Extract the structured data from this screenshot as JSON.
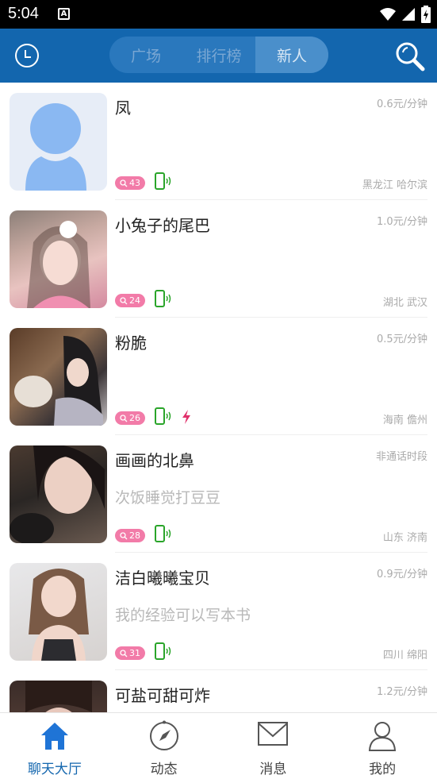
{
  "status_bar": {
    "time": "5:04",
    "notif_letter": "A"
  },
  "header": {
    "tabs": [
      {
        "label": "广场"
      },
      {
        "label": "排行榜"
      },
      {
        "label": "新人",
        "active": true
      }
    ],
    "icons": {
      "left": "clock-icon",
      "right": "search-icon"
    }
  },
  "users": [
    {
      "name": "凤",
      "price": "0.6元/分钟",
      "signature": "",
      "location": "黑龙江 哈尔滨",
      "count": "43",
      "hot": false,
      "avatar": "default"
    },
    {
      "name": "小兔子的尾巴",
      "price": "1.0元/分钟",
      "signature": "",
      "location": "湖北 武汉",
      "count": "24",
      "hot": false,
      "avatar": "photo"
    },
    {
      "name": "粉脆",
      "price": "0.5元/分钟",
      "signature": "",
      "location": "海南 儋州",
      "count": "26",
      "hot": true,
      "avatar": "photo"
    },
    {
      "name": "画画的北鼻",
      "price": "非通话时段",
      "signature": "次饭睡觉打豆豆",
      "location": "山东 济南",
      "count": "28",
      "hot": false,
      "avatar": "photo"
    },
    {
      "name": "洁白曦曦宝贝",
      "price": "0.9元/分钟",
      "signature": "我的经验可以写本书",
      "location": "四川 绵阳",
      "count": "31",
      "hot": false,
      "avatar": "photo"
    },
    {
      "name": "可盐可甜可炸",
      "price": "1.2元/分钟",
      "signature": "",
      "location": "",
      "count": "",
      "hot": false,
      "avatar": "photo"
    }
  ],
  "bottom_nav": [
    {
      "label": "聊天大厅",
      "icon": "home-icon",
      "active": true
    },
    {
      "label": "动态",
      "icon": "compass-icon",
      "active": false
    },
    {
      "label": "消息",
      "icon": "mail-icon",
      "active": false
    },
    {
      "label": "我的",
      "icon": "person-icon",
      "active": false
    }
  ],
  "colors": {
    "header": "#1366ae",
    "badge": "#f27ba8",
    "phone": "#2aa52a",
    "bolt": "#e0306b"
  }
}
